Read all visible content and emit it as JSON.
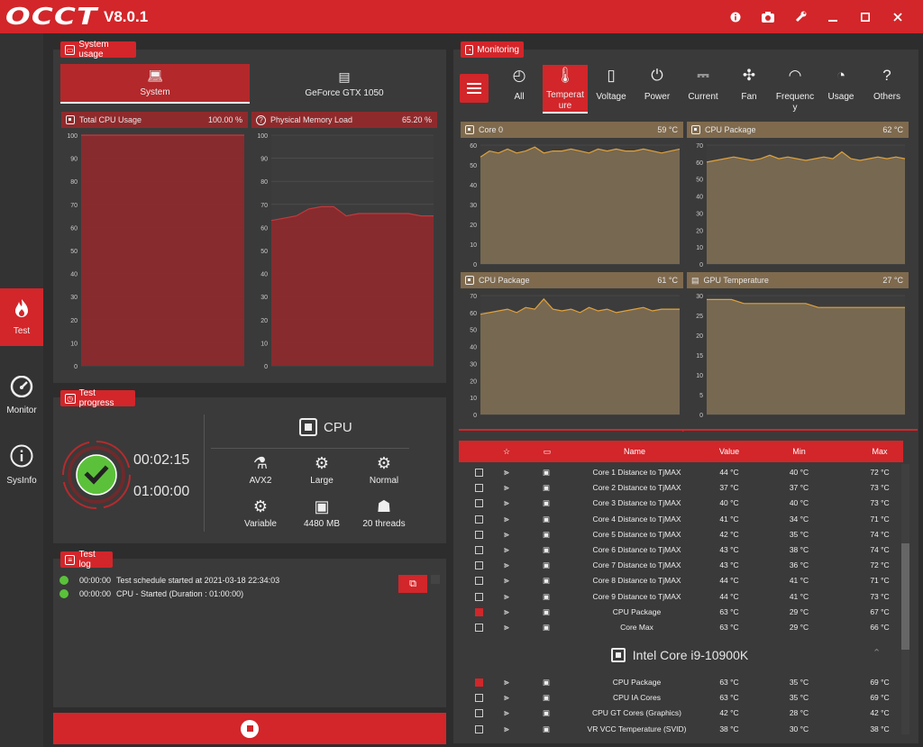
{
  "app": {
    "logo": "OCCT",
    "version": "V8.0.1"
  },
  "titlebar_icons": [
    "info-icon",
    "camera-icon",
    "wrench-icon",
    "minimize-icon",
    "maximize-icon",
    "close-icon"
  ],
  "sidebar": {
    "items": [
      {
        "label": "Test",
        "icon": "flame-icon"
      },
      {
        "label": "Monitor",
        "icon": "gauge-icon"
      },
      {
        "label": "SysInfo",
        "icon": "info-icon"
      }
    ]
  },
  "system_usage": {
    "title": "System usage",
    "tabs": [
      {
        "label": "System"
      },
      {
        "label": "GeForce GTX 1050"
      }
    ],
    "charts": [
      {
        "title": "Total CPU Usage",
        "value": "100.00 %"
      },
      {
        "title": "Physical Memory Load",
        "value": "65.20 %"
      }
    ]
  },
  "test_progress": {
    "title": "Test progress",
    "elapsed": "00:02:15",
    "duration": "01:00:00",
    "device": "CPU",
    "params": [
      {
        "label": "AVX2",
        "icon": "flask-icon"
      },
      {
        "label": "Large",
        "icon": "gears-icon"
      },
      {
        "label": "Normal",
        "icon": "gears-icon"
      },
      {
        "label": "Variable",
        "icon": "gears-icon"
      },
      {
        "label": "4480 MB",
        "icon": "chip-icon"
      },
      {
        "label": "20 threads",
        "icon": "worker-icon"
      }
    ]
  },
  "test_log": {
    "title": "Test log",
    "lines": [
      {
        "time": "00:00:00",
        "text": "Test schedule started at 2021-03-18 22:34:03"
      },
      {
        "time": "00:00:00",
        "text": "CPU - Started (Duration : 01:00:00)"
      }
    ]
  },
  "monitoring": {
    "title": "Monitoring",
    "tabs": [
      {
        "label": "All"
      },
      {
        "label": "Temperature"
      },
      {
        "label": "Voltage"
      },
      {
        "label": "Power"
      },
      {
        "label": "Current"
      },
      {
        "label": "Fan"
      },
      {
        "label": "Frequency"
      },
      {
        "label": "Usage"
      },
      {
        "label": "Others"
      }
    ],
    "charts": [
      {
        "title": "Core 0",
        "value": "59 °C"
      },
      {
        "title": "CPU Package",
        "value": "62 °C"
      },
      {
        "title": "CPU Package",
        "value": "61 °C"
      },
      {
        "title": "GPU Temperature",
        "value": "27 °C"
      }
    ]
  },
  "table": {
    "headers": {
      "name": "Name",
      "value": "Value",
      "min": "Min",
      "max": "Max"
    },
    "rows": [
      {
        "checked": false,
        "name": "Core 1 Distance to TjMAX",
        "value": "44 °C",
        "min": "40 °C",
        "max": "72 °C"
      },
      {
        "checked": false,
        "name": "Core 2 Distance to TjMAX",
        "value": "37 °C",
        "min": "37 °C",
        "max": "73 °C"
      },
      {
        "checked": false,
        "name": "Core 3 Distance to TjMAX",
        "value": "40 °C",
        "min": "40 °C",
        "max": "73 °C"
      },
      {
        "checked": false,
        "name": "Core 4 Distance to TjMAX",
        "value": "41 °C",
        "min": "34 °C",
        "max": "71 °C"
      },
      {
        "checked": false,
        "name": "Core 5 Distance to TjMAX",
        "value": "42 °C",
        "min": "35 °C",
        "max": "74 °C"
      },
      {
        "checked": false,
        "name": "Core 6 Distance to TjMAX",
        "value": "43 °C",
        "min": "38 °C",
        "max": "74 °C"
      },
      {
        "checked": false,
        "name": "Core 7 Distance to TjMAX",
        "value": "43 °C",
        "min": "36 °C",
        "max": "72 °C"
      },
      {
        "checked": false,
        "name": "Core 8 Distance to TjMAX",
        "value": "44 °C",
        "min": "41 °C",
        "max": "71 °C"
      },
      {
        "checked": false,
        "name": "Core 9 Distance to TjMAX",
        "value": "44 °C",
        "min": "41 °C",
        "max": "73 °C"
      },
      {
        "checked": true,
        "name": "CPU Package",
        "value": "63 °C",
        "min": "29 °C",
        "max": "67 °C"
      },
      {
        "checked": false,
        "name": "Core Max",
        "value": "63 °C",
        "min": "29 °C",
        "max": "66 °C"
      }
    ],
    "group_title": "Intel Core i9-10900K",
    "group_rows": [
      {
        "checked": true,
        "name": "CPU Package",
        "value": "63 °C",
        "min": "35 °C",
        "max": "69 °C"
      },
      {
        "checked": false,
        "name": "CPU IA Cores",
        "value": "63 °C",
        "min": "35 °C",
        "max": "69 °C"
      },
      {
        "checked": false,
        "name": "CPU GT Cores (Graphics)",
        "value": "42 °C",
        "min": "28 °C",
        "max": "42 °C"
      },
      {
        "checked": false,
        "name": "VR VCC Temperature (SVID)",
        "value": "38 °C",
        "min": "30 °C",
        "max": "38 °C"
      }
    ]
  },
  "chart_data": [
    {
      "type": "area",
      "title": "Total CPU Usage",
      "ylim": [
        0,
        100
      ],
      "yticks": [
        0,
        10,
        20,
        30,
        40,
        50,
        60,
        70,
        80,
        90,
        100
      ],
      "series": [
        {
          "values": [
            100,
            100,
            100,
            100,
            100,
            100,
            100,
            100,
            100,
            100
          ]
        }
      ]
    },
    {
      "type": "area",
      "title": "Physical Memory Load",
      "ylim": [
        0,
        100
      ],
      "yticks": [
        0,
        10,
        20,
        30,
        40,
        50,
        60,
        70,
        80,
        90,
        100
      ],
      "series": [
        {
          "values": [
            63,
            64,
            65,
            68,
            69,
            69,
            65,
            66,
            66,
            66,
            66,
            66,
            65,
            65
          ]
        }
      ]
    },
    {
      "type": "area",
      "title": "Core 0",
      "ylim": [
        0,
        60
      ],
      "yticks": [
        0,
        10,
        20,
        30,
        40,
        50,
        60
      ],
      "series": [
        {
          "values": [
            54,
            57,
            56,
            58,
            56,
            57,
            59,
            56,
            57,
            57,
            58,
            57,
            56,
            58,
            57,
            58,
            57,
            57,
            58,
            57,
            56,
            57,
            58
          ]
        }
      ]
    },
    {
      "type": "area",
      "title": "CPU Package",
      "ylim": [
        0,
        70
      ],
      "yticks": [
        0,
        10,
        20,
        30,
        40,
        50,
        60,
        70
      ],
      "series": [
        {
          "values": [
            60,
            61,
            62,
            63,
            62,
            61,
            62,
            64,
            62,
            63,
            62,
            61,
            62,
            63,
            62,
            66,
            62,
            61,
            62,
            63,
            62,
            63,
            62
          ]
        }
      ]
    },
    {
      "type": "area",
      "title": "CPU Package",
      "ylim": [
        0,
        70
      ],
      "yticks": [
        0,
        10,
        20,
        30,
        40,
        50,
        60,
        70
      ],
      "series": [
        {
          "values": [
            59,
            60,
            61,
            62,
            60,
            63,
            62,
            68,
            62,
            61,
            62,
            60,
            63,
            61,
            62,
            60,
            61,
            62,
            63,
            61,
            62,
            62,
            62
          ]
        }
      ]
    },
    {
      "type": "area",
      "title": "GPU Temperature",
      "ylim": [
        0,
        30
      ],
      "yticks": [
        0,
        5,
        10,
        15,
        20,
        25,
        30
      ],
      "series": [
        {
          "values": [
            29,
            29,
            29,
            28,
            28,
            28,
            28,
            28,
            28,
            27,
            27,
            27,
            27,
            27,
            27,
            27,
            27
          ]
        }
      ]
    }
  ]
}
